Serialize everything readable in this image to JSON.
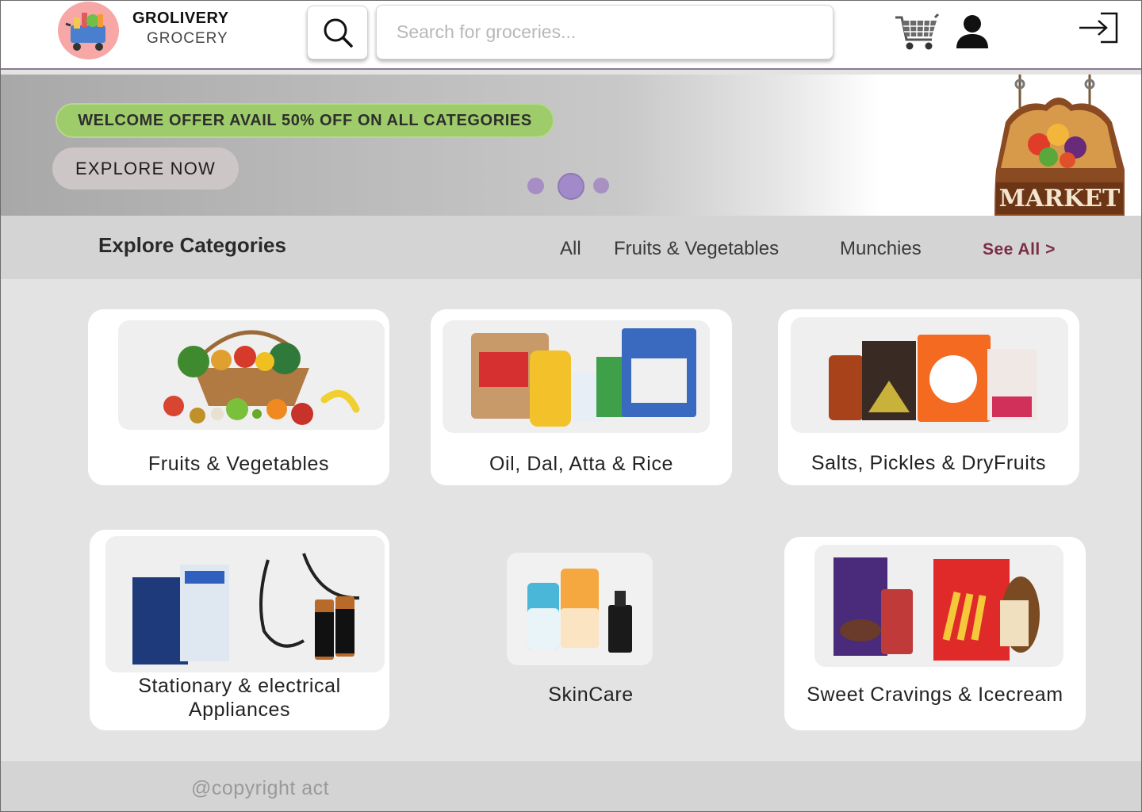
{
  "header": {
    "brand_name": "GROLIVERY",
    "brand_sub": "GROCERY",
    "search_placeholder": "Search for groceries..."
  },
  "banner": {
    "offer_text": "WELCOME OFFER AVAIL 50% OFF ON ALL CATEGORIES",
    "explore_label": "EXPLORE NOW",
    "carousel": {
      "slide_count": 3,
      "active_index": 1
    },
    "sign_text": "MARKET"
  },
  "categories_bar": {
    "title": "Explore Categories",
    "tabs": [
      "All",
      "Fruits & Vegetables",
      "Munchies"
    ],
    "see_all": "See All >"
  },
  "cards": [
    {
      "label": "Fruits & Vegetables"
    },
    {
      "label": "Oil, Dal, Atta & Rice"
    },
    {
      "label": "Salts, Pickles & DryFruits"
    },
    {
      "label_line1": "Stationary & electrical",
      "label_line2": "Appliances"
    },
    {
      "label": "SkinCare"
    },
    {
      "label": "Sweet Cravings & Icecream"
    }
  ],
  "footer": {
    "copyright": "@copyright act"
  },
  "colors": {
    "offer_green": "#9fcc6b",
    "see_all": "#7a2d44",
    "carousel_dot": "#a68dc4",
    "logo_bg": "#f7a8a6"
  }
}
